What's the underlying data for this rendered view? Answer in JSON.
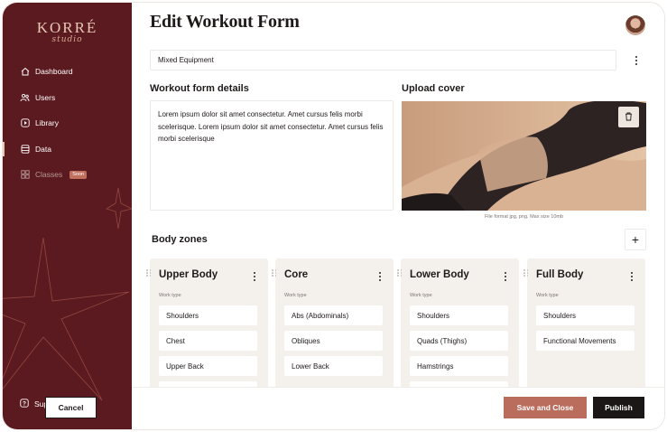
{
  "brand": {
    "name": "KORRÉ",
    "tagline": "studio"
  },
  "sidebar": {
    "items": [
      {
        "label": "Dashboard",
        "icon": "home-icon"
      },
      {
        "label": "Users",
        "icon": "users-icon"
      },
      {
        "label": "Library",
        "icon": "play-icon"
      },
      {
        "label": "Data",
        "icon": "database-icon",
        "active": true
      },
      {
        "label": "Classes",
        "icon": "grid-icon",
        "badge": "Soon",
        "disabled": true
      }
    ],
    "support_label": "Support"
  },
  "header": {
    "title": "Edit Workout Form"
  },
  "equipment": {
    "value": "Mixed Equipment"
  },
  "details": {
    "heading": "Workout form details",
    "text": "Lorem ipsum dolor sit amet consectetur. Amet cursus felis morbi scelerisque. Lorem ipsum dolor sit amet consectetur. Amet cursus felis morbi scelerisque"
  },
  "cover": {
    "heading": "Upload cover",
    "note": "File format jpg, png. Max size 10mb"
  },
  "body_zones": {
    "heading": "Body zones",
    "add_label": "+",
    "work_type_label": "Work type",
    "zones": [
      {
        "title": "Upper Body",
        "items": [
          "Shoulders",
          "Chest",
          "Upper Back",
          ""
        ]
      },
      {
        "title": "Core",
        "items": [
          "Abs (Abdominals)",
          "Obliques",
          "Lower Back"
        ]
      },
      {
        "title": "Lower Body",
        "items": [
          "Shoulders",
          "Quads (Thighs)",
          "Hamstrings",
          ""
        ]
      },
      {
        "title": "Full Body",
        "items": [
          "Shoulders",
          "Functional Movements"
        ]
      }
    ]
  },
  "footer": {
    "cancel_label": "Cancel",
    "save_label": "Save and Close",
    "publish_label": "Publish"
  },
  "colors": {
    "sidebar_bg": "#5b1a20",
    "accent": "#bb6d5d",
    "primary_dark": "#1c1717",
    "zone_bg": "#f4f1ed"
  }
}
